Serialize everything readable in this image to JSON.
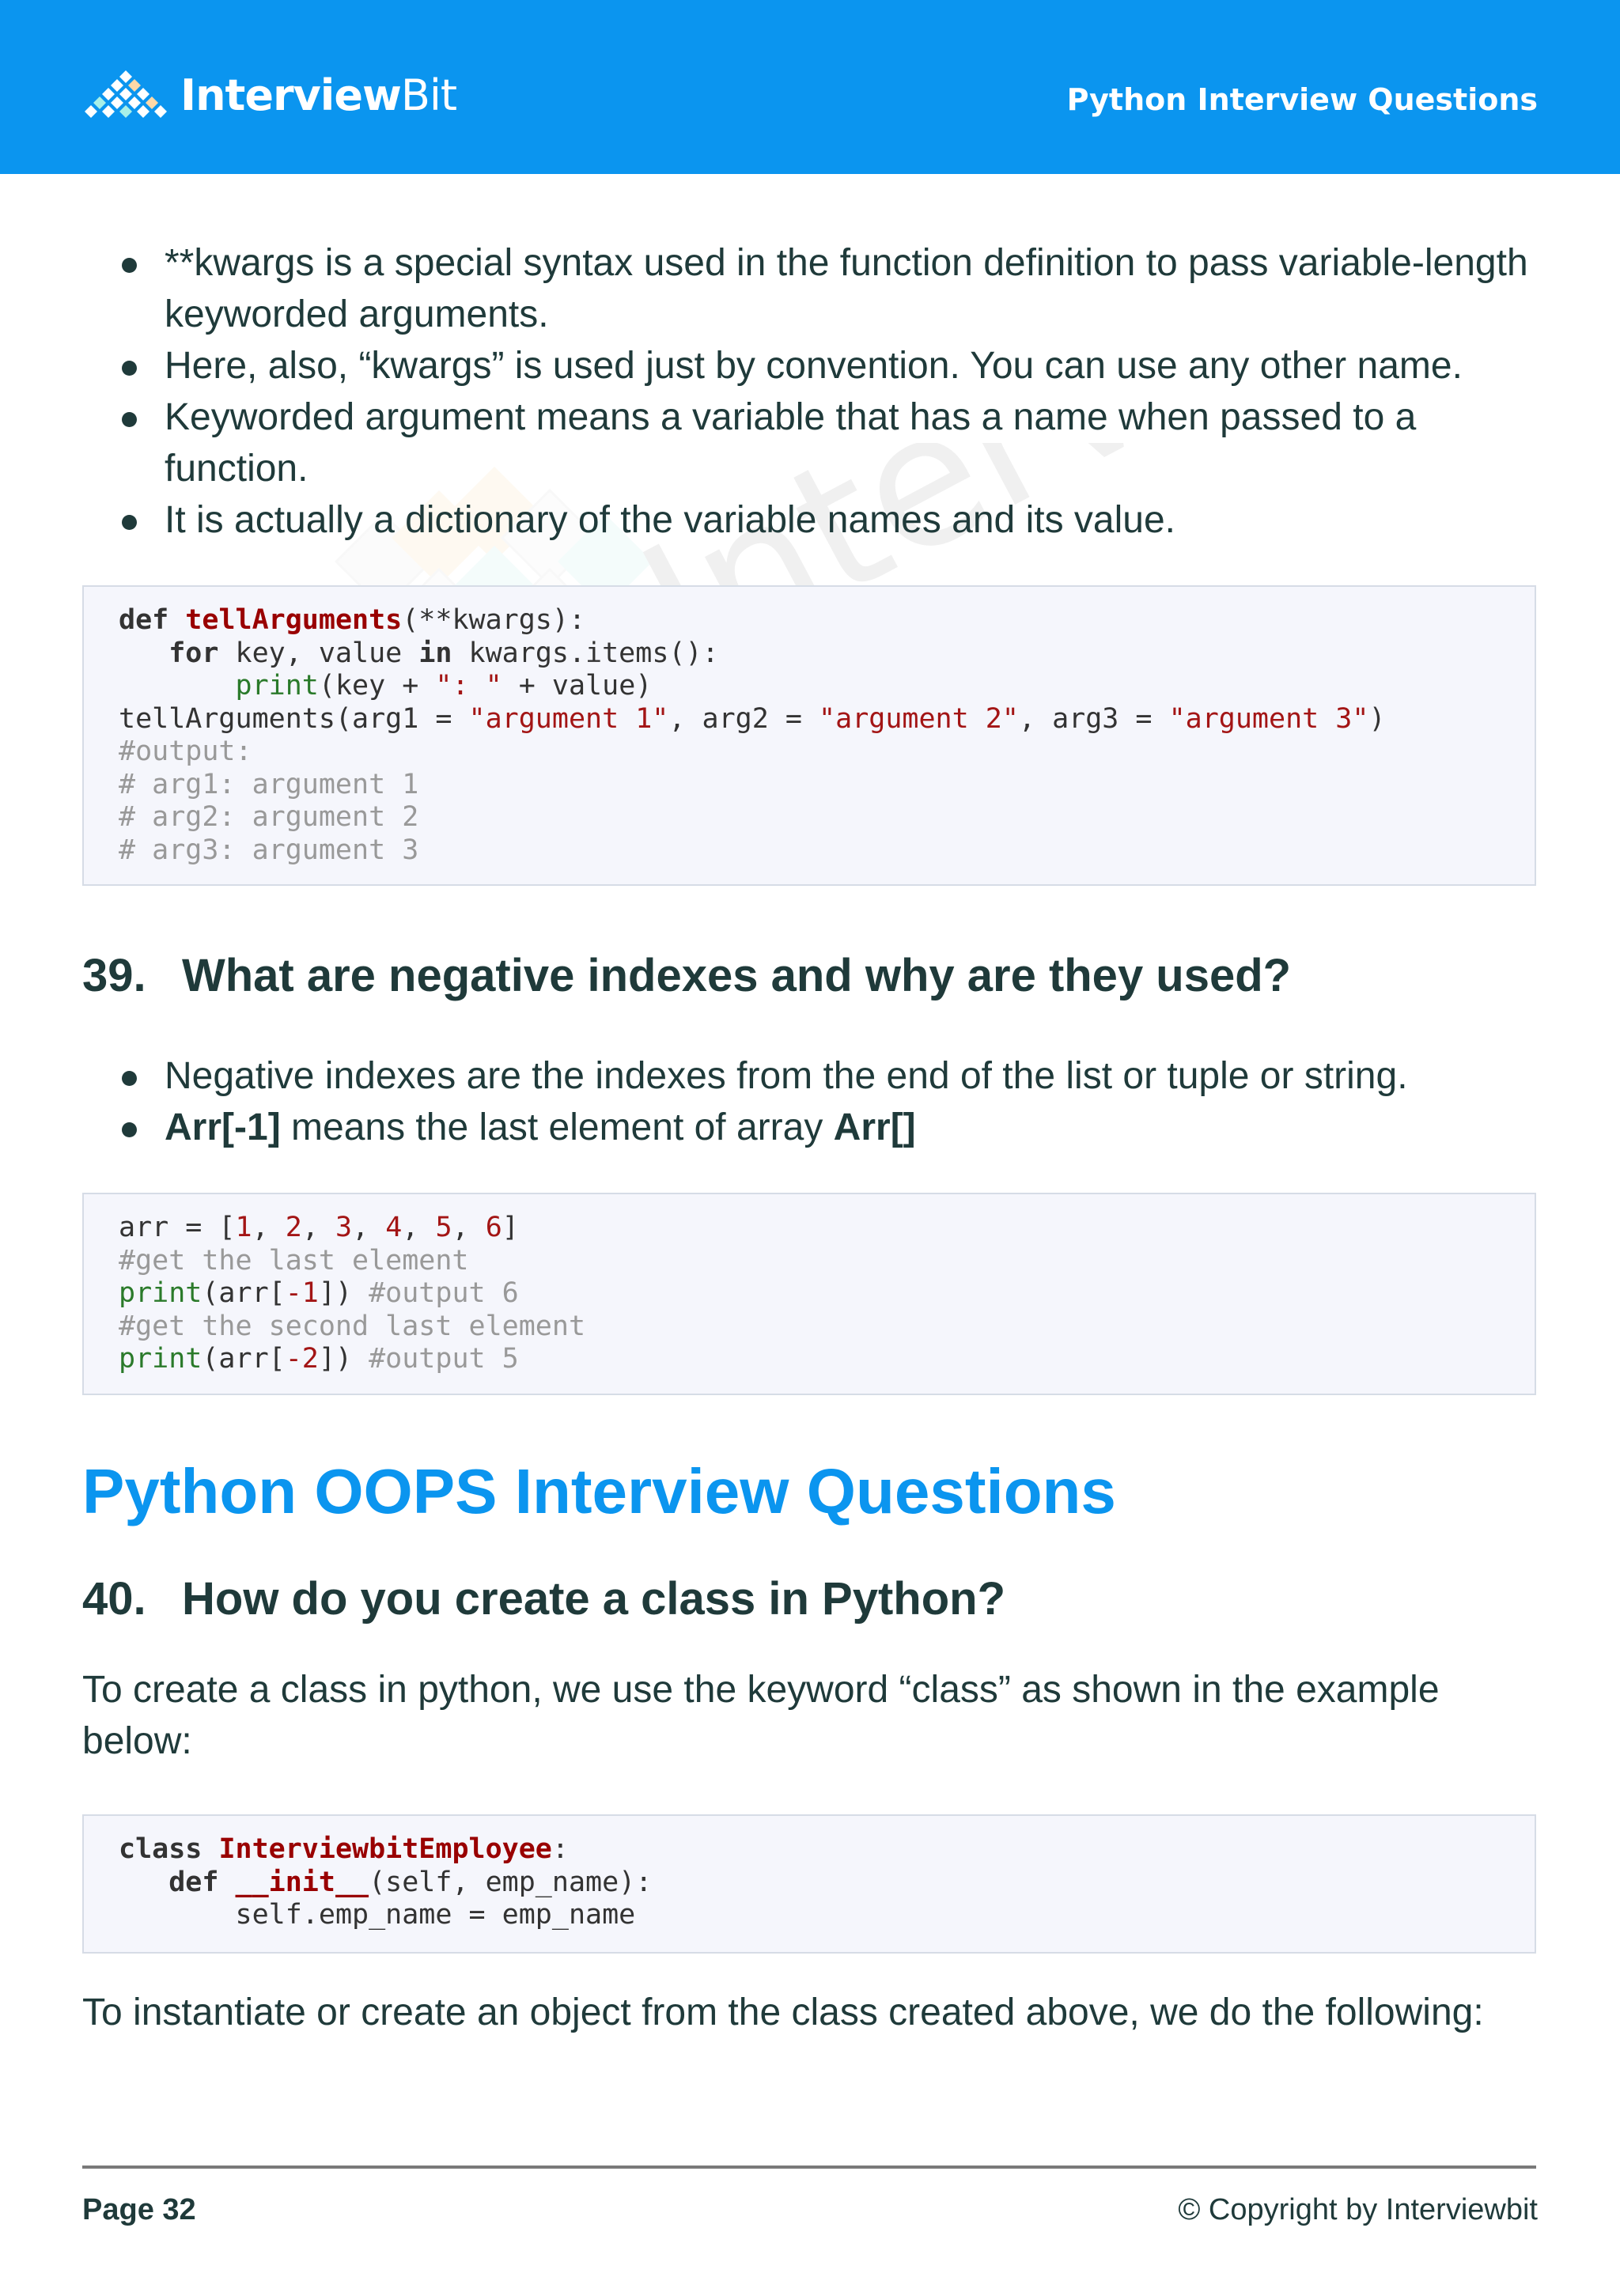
{
  "header": {
    "brand_bold": "Interview",
    "brand_light": "Bit",
    "title": "Python Interview Questions",
    "color": "#0b95ef"
  },
  "kwargs_bullets": [
    "**kwargs is a special syntax used in the function definition to pass variable-length keyworded arguments.",
    "Here, also, “kwargs” is used just by convention. You can use any other name.",
    "Keyworded argument means a variable that has a name when passed to a function.",
    "It is actually a dictionary of the variable names and its value."
  ],
  "code1": {
    "l1": [
      "def",
      "tellArguments",
      "(**kwargs):"
    ],
    "l2": [
      "for",
      " key, value ",
      "in",
      " kwargs.items():"
    ],
    "l3": [
      "print",
      "(key + ",
      "\": \"",
      " + value)"
    ],
    "l4": [
      "tellArguments(arg1 = ",
      "\"argument 1\"",
      ", arg2 = ",
      "\"argument 2\"",
      ", arg3 = ",
      "\"argument 3\"",
      ")"
    ],
    "comments": [
      "#output:",
      "# arg1: argument 1",
      "# arg2: argument 2",
      "# arg3: argument 3"
    ]
  },
  "q39": {
    "number": "39.",
    "title": "What are negative indexes and why are they used?",
    "bullet1": "Negative indexes are the indexes from the end of the list or tuple or string.",
    "bullet2_bold": "Arr[-1]",
    "bullet2_text": " means the last element of array ",
    "bullet2_bold2": "Arr[]"
  },
  "code2": {
    "l1_prefix": "arr = [",
    "numbers": [
      "1",
      "2",
      "3",
      "4",
      "5",
      "6"
    ],
    "comment1": "#get the last element",
    "print": "print",
    "idx1": "-1",
    "out1": "#output 6",
    "comment2": "#get the second last element",
    "idx2": "-2",
    "out2": "#output 5"
  },
  "section_title": "Python OOPS Interview Questions",
  "q40": {
    "number": "40.",
    "title": "How do you create a class in Python?",
    "para": "To create a class in python, we use the keyword “class” as shown in the example below:"
  },
  "code3": {
    "kw_class": "class",
    "class_name": "InterviewbitEmployee",
    "colon": ":",
    "kw_def": "def",
    "init": "__init__",
    "init_args": "(self, emp_name):",
    "body": "self.emp_name = emp_name"
  },
  "para2": "To instantiate or create an object from the class created above, we do the following:",
  "footer": {
    "page": "Page 32",
    "copyright": "© Copyright by Interviewbit"
  }
}
